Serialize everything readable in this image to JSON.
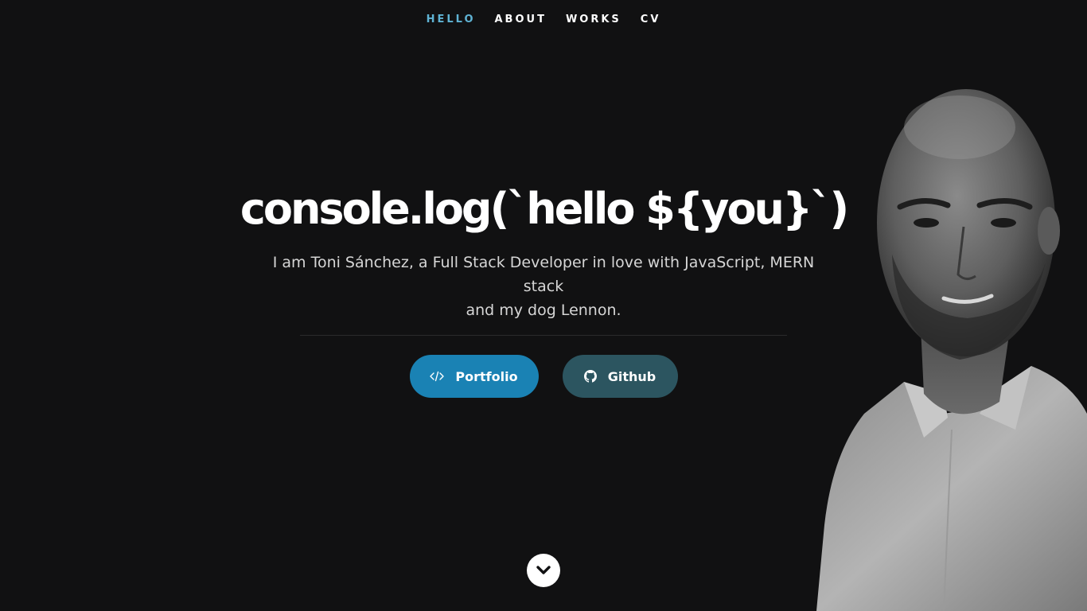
{
  "nav": {
    "items": [
      {
        "label": "HELLO",
        "active": true
      },
      {
        "label": "ABOUT",
        "active": false
      },
      {
        "label": "WORKS",
        "active": false
      },
      {
        "label": "CV",
        "active": false
      }
    ],
    "active_color": "#5fb3d4"
  },
  "hero": {
    "title": "console.log(`hello ${you}`)",
    "subtitle_line1": "I am Toni Sánchez, a Full Stack Developer in love with JavaScript, MERN stack",
    "subtitle_line2": "and my dog Lennon."
  },
  "buttons": {
    "portfolio_label": "Portfolio",
    "portfolio_icon": "code-icon",
    "portfolio_color": "#1a82b4",
    "github_label": "Github",
    "github_icon": "github-icon",
    "github_color": "#2c5560"
  },
  "scroll": {
    "icon": "chevron-down-icon"
  },
  "colors": {
    "background": "#111112",
    "text": "#ffffff"
  }
}
